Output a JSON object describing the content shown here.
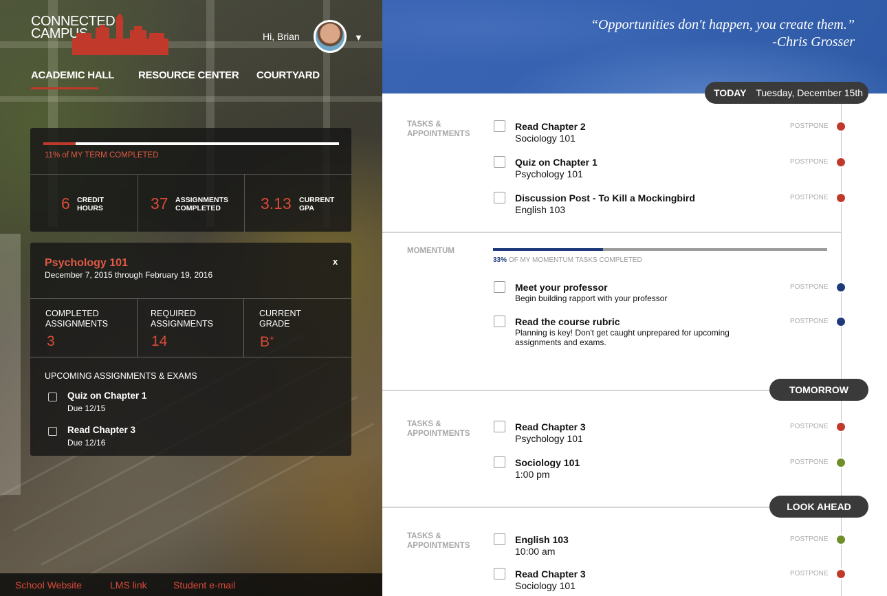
{
  "brand": {
    "line1": "CONNECTED",
    "line2": "CAMPUS"
  },
  "user": {
    "greeting": "Hi, Brian"
  },
  "nav": {
    "items": [
      "ACADEMIC HALL",
      "RESOURCE CENTER",
      "COURTYARD"
    ],
    "active": "ACADEMIC HALL"
  },
  "term": {
    "progress": 0.11,
    "progress_text": "11% of MY TERM COMPLETED",
    "stats": [
      {
        "value": "6",
        "label_line1": "CREDIT",
        "label_line2": "HOURS"
      },
      {
        "value": "37",
        "label_line1": "ASSIGNMENTS",
        "label_line2": "COMPLETED"
      },
      {
        "value": "3.13",
        "label_line1": "CURRENT",
        "label_line2": "GPA"
      }
    ]
  },
  "course": {
    "title": "Psychology 101",
    "dates": "December 7, 2015 through February 19, 2016",
    "close": "x",
    "stats": [
      {
        "label_line1": "COMPLETED",
        "label_line2": "ASSIGNMENTS",
        "value": "3"
      },
      {
        "label_line1": "REQUIRED",
        "label_line2": "ASSIGNMENTS",
        "value": "14"
      },
      {
        "label_line1": "CURRENT",
        "label_line2": "GRADE",
        "value": "B",
        "value_sup": "+"
      }
    ],
    "upcoming_title": "UPCOMING ASSIGNMENTS & EXAMS",
    "upcoming": [
      {
        "title": "Quiz on Chapter 1",
        "due": "Due 12/15"
      },
      {
        "title": "Read Chapter 3",
        "due": "Due 12/16"
      }
    ]
  },
  "footer": {
    "links": [
      "School Website",
      "LMS link",
      "Student e-mail"
    ]
  },
  "quote": {
    "text": "“Opportunities don't happen, you create them.”",
    "author": "-Chris Grosser"
  },
  "colors": {
    "red": "#c0392b",
    "navy": "#1f3a7a",
    "green": "#6e8e2a",
    "dark_pill": "#3a3a3a"
  },
  "timeline": {
    "today": {
      "label": "TODAY",
      "date": "Tuesday, December 15th"
    },
    "section_tasks_line1": "TASKS &",
    "section_tasks_line2": "APPOINTMENTS",
    "today_tasks": [
      {
        "title": "Read Chapter 2",
        "sub": "Sociology 101",
        "action": "POSTPONE",
        "dot": "red"
      },
      {
        "title": "Quiz on Chapter 1",
        "sub": "Psychology 101",
        "action": "POSTPONE",
        "dot": "red"
      },
      {
        "title": "Discussion Post - To Kill a Mockingbird",
        "sub": "English 103",
        "action": "POSTPONE",
        "dot": "red"
      }
    ],
    "momentum": {
      "label": "MOMENTUM",
      "progress": 0.33,
      "percent": "33%",
      "progress_text": "OF MY MOMENTUM TASKS COMPLETED",
      "tasks": [
        {
          "title": "Meet your professor",
          "desc": "Begin building rapport with your professor",
          "action": "POSTPONE",
          "dot": "navy"
        },
        {
          "title": "Read the course rubric",
          "desc": "Planning is key! Don't get caught unprepared for upcoming assignments and exams.",
          "action": "POSTPONE",
          "dot": "navy"
        }
      ]
    },
    "tomorrow": {
      "label": "TOMORROW"
    },
    "tomorrow_tasks": [
      {
        "title": "Read Chapter 3",
        "sub": "Psychology 101",
        "action": "POSTPONE",
        "dot": "red"
      },
      {
        "title": "Sociology 101",
        "sub": "1:00 pm",
        "action": "POSTPONE",
        "dot": "green"
      }
    ],
    "lookahead": {
      "label": "LOOK AHEAD"
    },
    "lookahead_tasks": [
      {
        "title": "English 103",
        "sub": "10:00 am",
        "action": "POSTPONE",
        "dot": "green"
      },
      {
        "title": "Read Chapter 3",
        "sub": "Sociology 101",
        "action": "POSTPONE",
        "dot": "red"
      }
    ]
  }
}
